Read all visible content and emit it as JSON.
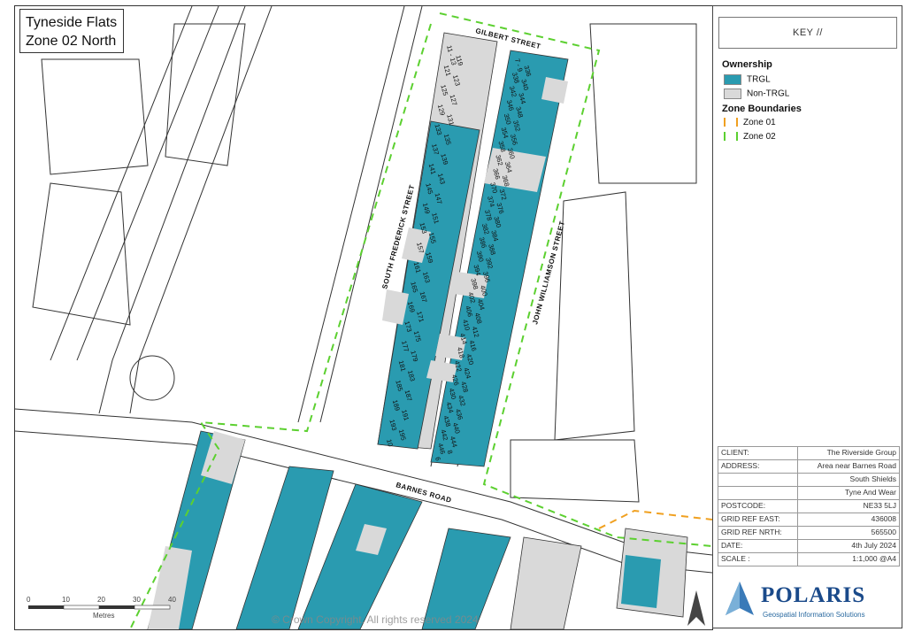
{
  "map": {
    "title_line1": "Tyneside Flats",
    "title_line2": "Zone 02 North",
    "copyright": "© Crown Copyright. All rights reserved 2024",
    "scale_ticks": [
      "0",
      "10",
      "20",
      "30",
      "40"
    ],
    "scale_unit": "Metres",
    "colors": {
      "trgl": "#2a9bb0",
      "non_trgl": "#d9d9d9",
      "zone01": "#f0a020",
      "zone02": "#5cd030"
    },
    "roads": {
      "gilbert": "GILBERT STREET",
      "south_frederick": "SOUTH FREDERICK STREET",
      "john_williamson": "JOHN WILLIAMSON STREET",
      "barnes": "BARNES ROAD"
    },
    "house_numbers_west": [
      "11 - 13",
      "119",
      "121",
      "123",
      "125",
      "127",
      "129",
      "131",
      "133",
      "135",
      "137",
      "139",
      "141",
      "143",
      "145",
      "147",
      "149",
      "151",
      "153",
      "155",
      "157",
      "159",
      "161",
      "163",
      "165",
      "167",
      "169",
      "171",
      "173",
      "175",
      "177",
      "179",
      "181",
      "183",
      "185",
      "187",
      "189",
      "191",
      "193",
      "195",
      "10"
    ],
    "house_numbers_east": [
      "7 - 9",
      "336",
      "338",
      "340",
      "342",
      "344",
      "346",
      "348",
      "350",
      "352",
      "354",
      "356",
      "358",
      "360",
      "362",
      "364",
      "366",
      "368",
      "370",
      "372",
      "374",
      "376",
      "378",
      "380",
      "382",
      "384",
      "386",
      "388",
      "390",
      "392",
      "394",
      "396",
      "398",
      "400",
      "402",
      "404",
      "406",
      "408",
      "410",
      "412",
      "414",
      "416",
      "418",
      "420",
      "422",
      "424",
      "426",
      "428",
      "430",
      "432",
      "434",
      "436",
      "438",
      "440",
      "442",
      "444",
      "446",
      "8",
      "6"
    ]
  },
  "key": {
    "header": "KEY //",
    "ownership_heading": "Ownership",
    "trgl_label": "TRGL",
    "non_trgl_label": "Non-TRGL",
    "zones_heading": "Zone Boundaries",
    "zone01_label": "Zone 01",
    "zone02_label": "Zone 02"
  },
  "info": [
    {
      "label": "CLIENT:",
      "value": "The Riverside Group"
    },
    {
      "label": "ADDRESS:",
      "value": "Area near Barnes Road"
    },
    {
      "label": "",
      "value": "South Shields"
    },
    {
      "label": "",
      "value": "Tyne And Wear"
    },
    {
      "label": "POSTCODE:",
      "value": "NE33 5LJ"
    },
    {
      "label": "GRID REF EAST:",
      "value": "436008"
    },
    {
      "label": "GRID REF NRTH:",
      "value": "565500"
    },
    {
      "label": "DATE:",
      "value": "4th July 2024"
    },
    {
      "label": "SCALE :",
      "value": "1:1,000 @A4"
    }
  ],
  "branding": {
    "name": "POLARIS",
    "subtitle": "Geospatial Information Solutions"
  }
}
